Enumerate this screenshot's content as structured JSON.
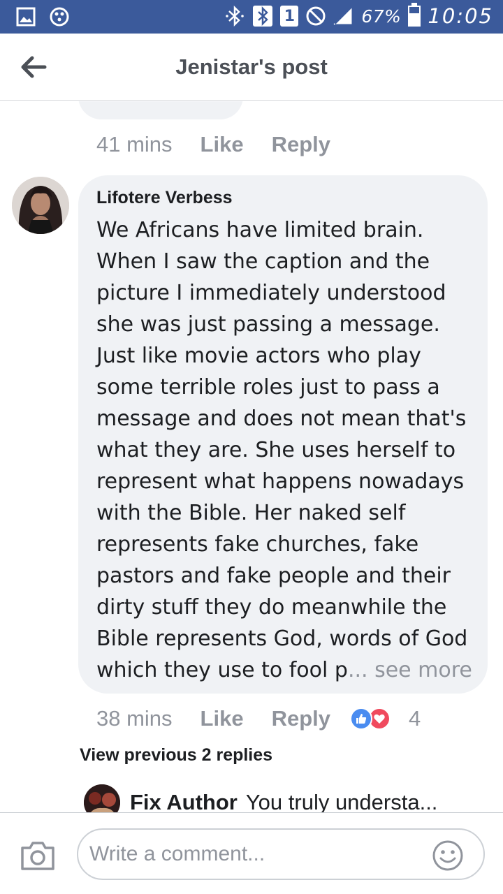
{
  "status_bar": {
    "battery": "67%",
    "time": "10:05",
    "sim_label": "1",
    "battery_level": 0.67,
    "icons": [
      "gallery-icon",
      "connection-icon",
      "bluetooth-icon",
      "bluetooth-icon",
      "sim-icon",
      "do-not-disturb-icon",
      "signal-icon",
      "battery-icon"
    ]
  },
  "header": {
    "title": "Jenistar's post",
    "back_icon": "arrow-left-icon"
  },
  "previous_comment": {
    "time": "41 mins",
    "like_label": "Like",
    "reply_label": "Reply"
  },
  "comment": {
    "author": "Lifotere Verbess",
    "text": "We Africans have limited brain. When I saw the caption and the picture I immediately understood she was just passing a message. Just like movie actors who play some terrible roles just to pass a message and does not mean that's what they are. She uses herself to represent what happens nowadays with the Bible. Her naked self represents fake churches, fake pastors and fake people and their dirty stuff they do meanwhile the Bible represents God, words of God which they use to fool p",
    "see_more": "... see more",
    "time": "38 mins",
    "like_label": "Like",
    "reply_label": "Reply",
    "reaction_count": "4",
    "reaction_icons": [
      "like-reaction-icon",
      "love-reaction-icon"
    ]
  },
  "replies": {
    "view_previous": "View previous 2 replies",
    "preview_author": "Fix Author",
    "preview_text": "You truly understa..."
  },
  "comment_bar": {
    "placeholder": "Write a comment...",
    "camera_icon": "camera-icon",
    "emoji_icon": "emoji-icon"
  },
  "colors": {
    "status_bar": "#3b5a9b",
    "bubble": "#f0f2f5",
    "meta_text": "#90949c",
    "like_reaction": "#4a8cf0",
    "love_reaction": "#f04a5e"
  }
}
